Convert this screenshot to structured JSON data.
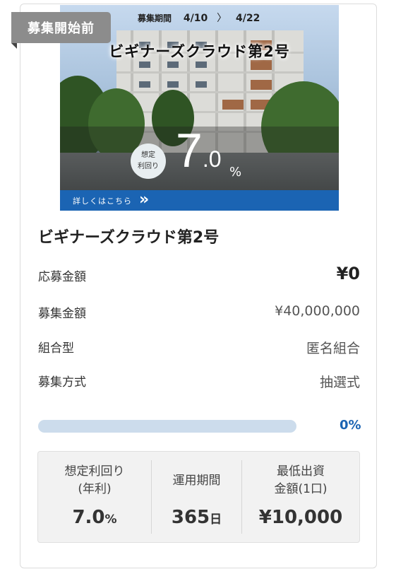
{
  "badge": "募集開始前",
  "banner": {
    "period_label": "募集期間",
    "period_start": "4/10",
    "period_arrow": "〉",
    "period_end": "4/22",
    "title": "ビギナーズクラウド第2号",
    "yield_label_line1": "想定",
    "yield_label_line2": "利回り",
    "yield_int": "7",
    "yield_dec": ".0",
    "yield_unit": "%",
    "detail_link": "詳しくはこちら",
    "detail_arrow": "»"
  },
  "title": "ビギナーズクラウド第2号",
  "rows": [
    {
      "key": "応募金額",
      "value": "¥0"
    },
    {
      "key": "募集金額",
      "value": "¥40,000,000"
    },
    {
      "key": "組合型",
      "value": "匿名組合"
    },
    {
      "key": "募集方式",
      "value": "抽選式"
    }
  ],
  "progress": {
    "fraction": 0.0,
    "label": "0%"
  },
  "stats": [
    {
      "label_line1": "想定利回り",
      "label_line2": "(年利)",
      "value": "7.0",
      "unit": "%"
    },
    {
      "label_line1": "運用期間",
      "label_line2": "",
      "value": "365",
      "unit": "日"
    },
    {
      "label_line1": "最低出資",
      "label_line2": "金額(1口)",
      "value": "¥10,000",
      "unit": ""
    }
  ],
  "colors": {
    "accent": "#1b64b3",
    "progress_track": "#ccdcec",
    "badge": "#8c8c8c"
  }
}
